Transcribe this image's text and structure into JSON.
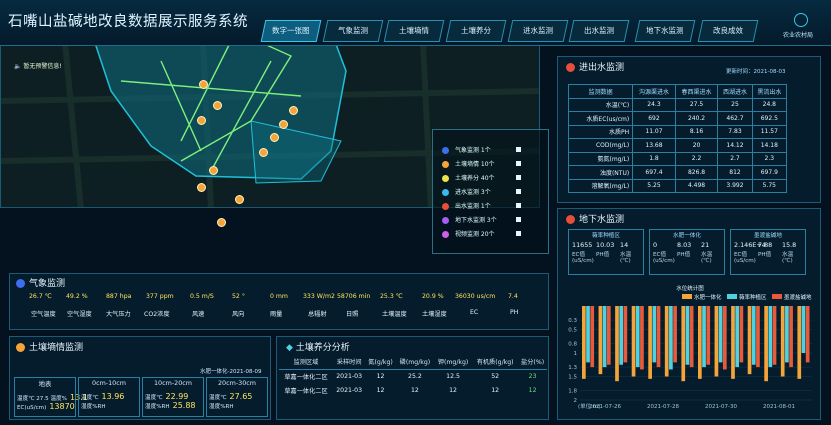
{
  "header": {
    "title": "石嘴山盐碱地改良数据展示服务系统",
    "nav": [
      "数字一张图",
      "气象监测",
      "土壤墒情",
      "土壤养分",
      "进水监测",
      "出水监测",
      "地下水监测",
      "改良成效"
    ],
    "user": "农业农村局"
  },
  "map": {
    "alert": "暂无预警信息!",
    "legend": [
      {
        "label": "气象监测 1个",
        "color": "#3d6ef0"
      },
      {
        "label": "土壤墒情 10个",
        "color": "#f5a43a"
      },
      {
        "label": "土壤养分 40个",
        "color": "#eee24a"
      },
      {
        "label": "进水监测 3个",
        "color": "#3cb8f0"
      },
      {
        "label": "出水监测 1个",
        "color": "#e84e3a"
      },
      {
        "label": "地下水监测 3个",
        "color": "#a45ef0"
      },
      {
        "label": "视频监测 20个",
        "color": "#d05ee8"
      }
    ]
  },
  "io": {
    "title": "进出水监测",
    "updated": "更新时间：2021-08-03",
    "headers": [
      "监测数据",
      "沟源渠进水",
      "春西渠进水",
      "西湖进水",
      "黑流出水"
    ],
    "rows": [
      [
        "水温(℃)",
        "24.3",
        "27.5",
        "25",
        "24.8"
      ],
      [
        "水质EC(us/cm)",
        "692",
        "240.2",
        "462.7",
        "692.5"
      ],
      [
        "水质PH",
        "11.07",
        "8.16",
        "7.83",
        "11.57"
      ],
      [
        "COD(mg/L)",
        "13.68",
        "20",
        "14.12",
        "14.18"
      ],
      [
        "氨氮(mg/L)",
        "1.8",
        "2.2",
        "2.7",
        "2.3"
      ],
      [
        "浊度(NTU)",
        "697.4",
        "826.8",
        "812",
        "697.9"
      ],
      [
        "溶解氧(mg/L)",
        "5.25",
        "4.498",
        "3.992",
        "5.75"
      ]
    ]
  },
  "gw": {
    "title": "地下水监测",
    "boxes": [
      {
        "name": "薇率种植区",
        "vals": [
          "11655",
          "10.03",
          "14"
        ],
        "labels": [
          "EC值",
          "PH值",
          "水温"
        ],
        "units": [
          "(uS/cm)",
          "",
          "(℃)"
        ]
      },
      {
        "name": "水肥一体化",
        "vals": [
          "0",
          "8.03",
          "21"
        ],
        "labels": [
          "EC值",
          "PH值",
          "水温"
        ],
        "units": [
          "(uS/cm)",
          "",
          "(℃)"
        ]
      },
      {
        "name": "墨渡盐碱地",
        "vals": [
          "2.146E+4",
          "7.88",
          "15.8"
        ],
        "labels": [
          "EC值",
          "PH值",
          "水温"
        ],
        "units": [
          "(uS/cm)",
          "",
          "(℃)"
        ]
      }
    ]
  },
  "weather": {
    "title": "气象监测",
    "values": [
      "26.7 ℃",
      "49.2 %",
      "887 hpa",
      "377 ppm",
      "0.5 m/S",
      "52 °",
      "0 mm",
      "333 W/m2",
      "58706 min",
      "25.3 ℃",
      "20.9 %",
      "36030 us/cm",
      "7.4"
    ],
    "labels": [
      "空气温度",
      "空气湿度",
      "大气压力",
      "CO2浓度",
      "风速",
      "风向",
      "雨量",
      "总辐射",
      "日照",
      "土壤温度",
      "土壤湿度",
      "EC",
      "PH"
    ]
  },
  "moisture": {
    "title": "土壤墒情监测",
    "top_label": "水肥一体化-2021-08-09",
    "cols": [
      {
        "head": "地表",
        "l1": "温度℃ 27.5 温度%",
        "v1": "13.1",
        "l2": "EC(uS/cm)",
        "v2": "13870"
      },
      {
        "head": "0cm-10cm",
        "l1": "温度℃",
        "v1": "13.96",
        "l2": "湿度%RH",
        "v2": ""
      },
      {
        "head": "10cm-20cm",
        "l1": "温度℃",
        "v1": "22.99",
        "l2": "湿度%RH",
        "v2": "25.88"
      },
      {
        "head": "20cm-30cm",
        "l1": "温度℃",
        "v1": "27.65",
        "l2": "湿度%RH",
        "v2": ""
      }
    ]
  },
  "nutrient": {
    "title": "土壤养分分析",
    "headers": [
      "监测区域",
      "采样时间",
      "氮(g/kg)",
      "磷(mg/kg)",
      "钾(mg/kg)",
      "有机质(g/kg)",
      "盐分(%)"
    ],
    "rows": [
      [
        "草嘉一体化二区",
        "2021-03",
        "12",
        "25.2",
        "12.5",
        "52",
        "23"
      ],
      [
        "草嘉一体化二区",
        "2021-03",
        "12",
        "12",
        "12",
        "12",
        "12"
      ]
    ]
  },
  "chart_data": {
    "type": "bar",
    "title": "水位统计图",
    "series": [
      {
        "name": "水肥一体化",
        "color": "#f5a43a",
        "values": [
          1.55,
          1.45,
          1.6,
          1.5,
          1.55,
          1.5,
          1.6,
          1.55,
          1.5,
          1.55,
          1.45,
          1.6,
          1.5,
          1.55
        ]
      },
      {
        "name": "薇率种植区",
        "color": "#4fd2e0",
        "values": [
          1.2,
          1.3,
          1.25,
          1.3,
          1.2,
          1.35,
          1.25,
          1.3,
          1.2,
          1.3,
          1.25,
          1.3,
          1.2,
          1.0
        ]
      },
      {
        "name": "墨渡盐碱地",
        "color": "#e85a3a",
        "values": [
          1.3,
          1.25,
          1.2,
          1.35,
          1.3,
          1.2,
          1.3,
          1.25,
          1.35,
          1.2,
          1.3,
          1.25,
          1.3,
          1.2
        ]
      }
    ],
    "x_ticks": [
      "2021-07-26",
      "2021-07-28",
      "2021-07-30",
      "2021-08-01"
    ],
    "y_ticks": [
      "0.3",
      "0.5",
      "0.8",
      "1",
      "1.3",
      "1.5",
      "1.8",
      "2"
    ],
    "ylim": [
      0,
      2
    ],
    "ylabel": "(单位:m)",
    "inverted": true
  }
}
